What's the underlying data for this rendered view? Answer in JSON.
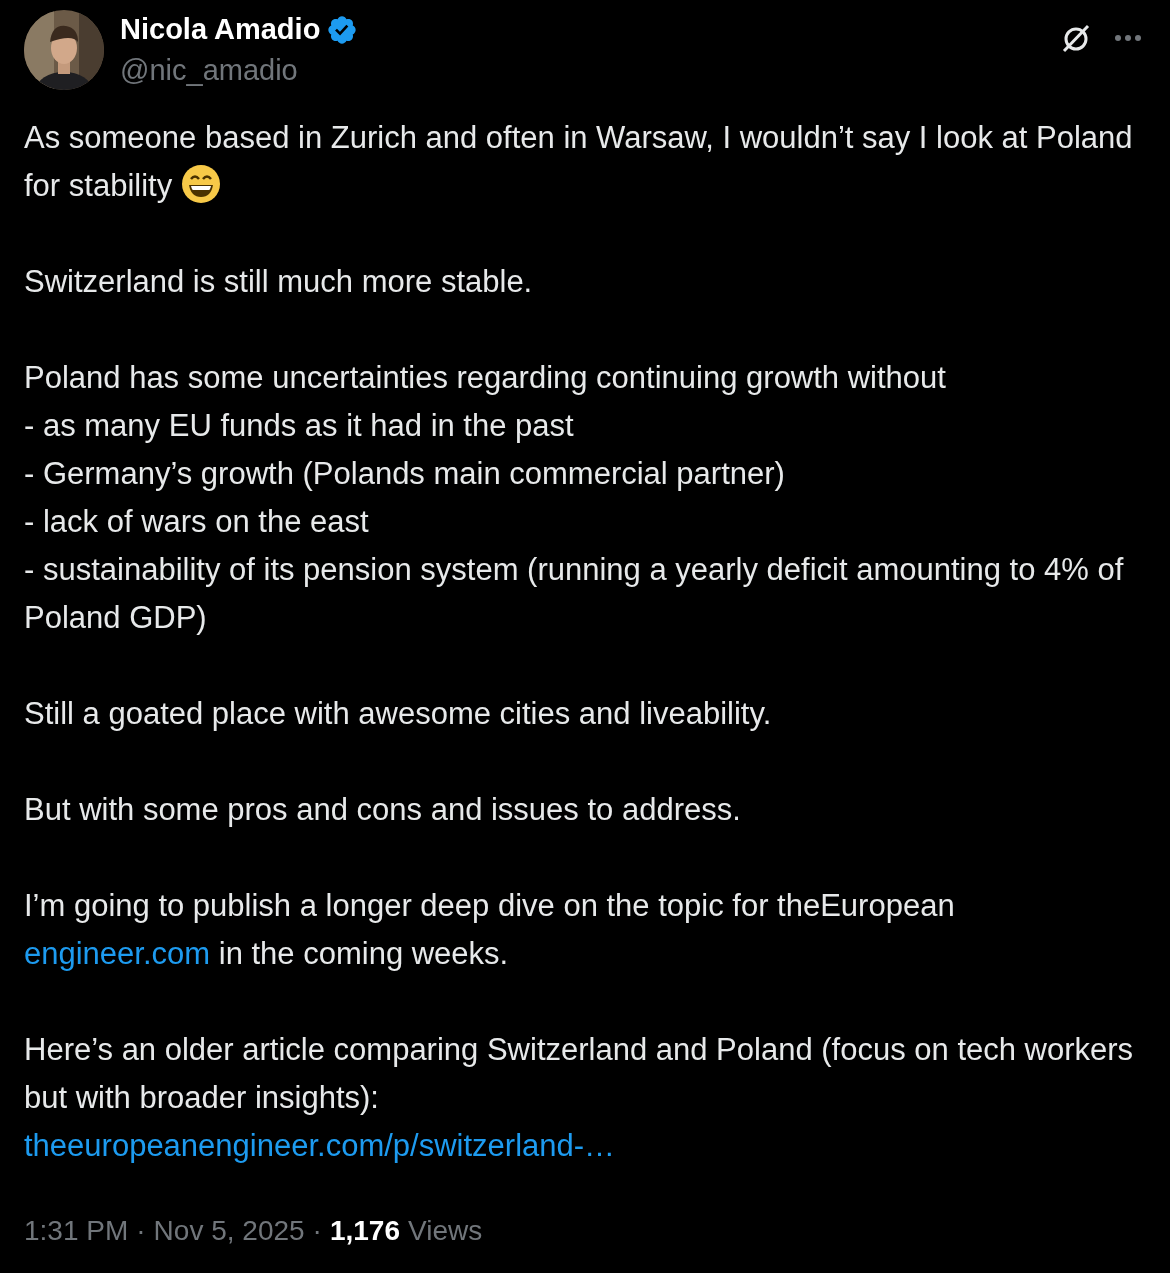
{
  "author": {
    "name": "Nicola Amadio",
    "verified": true,
    "handle": "@nic_amadio"
  },
  "body": [
    {
      "lines": [
        [
          {
            "kind": "text",
            "text": "As someone based in Zurich and often in Warsaw, I wouldn’t say I look at Poland for stability "
          },
          {
            "kind": "emoji"
          }
        ]
      ]
    },
    {
      "lines": [
        [
          {
            "kind": "text",
            "text": "Switzerland is still much more stable."
          }
        ]
      ]
    },
    {
      "lines": [
        [
          {
            "kind": "text",
            "text": "Poland has some uncertainties regarding continuing growth without"
          }
        ],
        [
          {
            "kind": "text",
            "text": "- as many EU funds as it had in the past"
          }
        ],
        [
          {
            "kind": "text",
            "text": "- Germany’s growth (Polands main commercial partner)"
          }
        ],
        [
          {
            "kind": "text",
            "text": "- lack of wars on the east"
          }
        ],
        [
          {
            "kind": "text",
            "text": "- sustainability of its pension system (running a yearly deficit amounting to 4% of Poland GDP)"
          }
        ]
      ]
    },
    {
      "lines": [
        [
          {
            "kind": "text",
            "text": "Still a goated place with awesome cities and liveability."
          }
        ]
      ]
    },
    {
      "lines": [
        [
          {
            "kind": "text",
            "text": "But with some pros and cons and issues to address."
          }
        ]
      ]
    },
    {
      "lines": [
        [
          {
            "kind": "text",
            "text": "I’m going to publish a longer deep dive on the topic for theEuropean "
          },
          {
            "kind": "link",
            "text": "engineer.com"
          },
          {
            "kind": "text",
            "text": " in the coming weeks."
          }
        ]
      ]
    },
    {
      "lines": [
        [
          {
            "kind": "text",
            "text": "Here’s an older article comparing Switzerland and Poland (focus on tech workers but with broader insights):"
          }
        ],
        [
          {
            "kind": "link",
            "text": "theeuropeanengineer.com/p/switzerland-…"
          }
        ]
      ]
    }
  ],
  "footer": {
    "time": "1:31 PM",
    "separator_1": "·",
    "date": "Nov 5, 2025",
    "separator_2": "·",
    "views_count": "1,176",
    "views_label": "Views"
  }
}
